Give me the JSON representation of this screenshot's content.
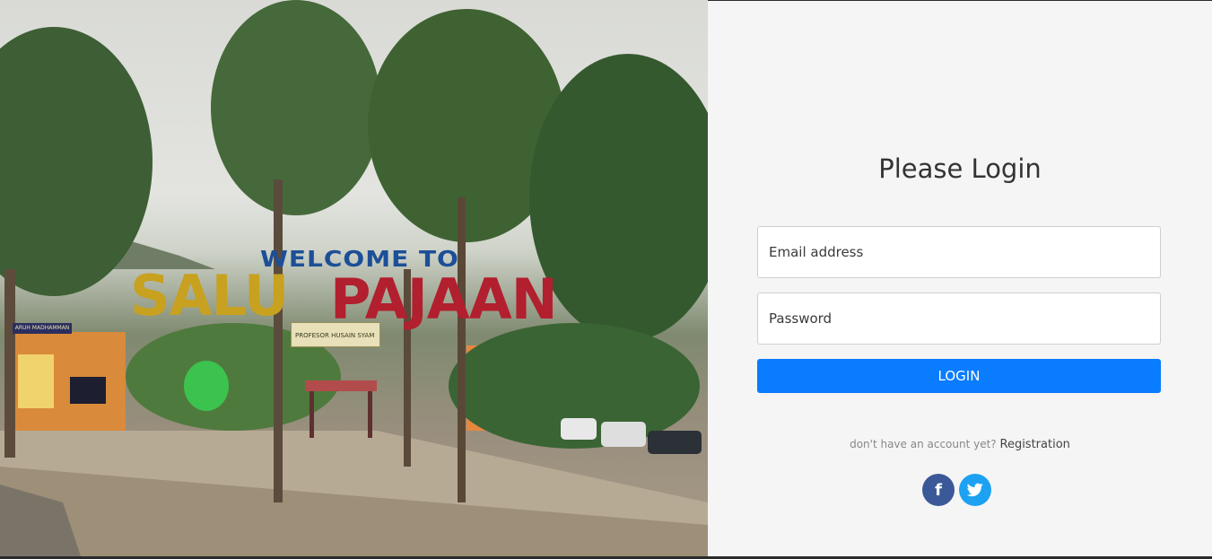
{
  "photo": {
    "sign_welcome": "WELCOME TO",
    "sign_salu": "SALU",
    "sign_pajaan": "PAJAAN",
    "banner_text": "PROFESOR HUSAIN SYAM",
    "mosque_sign": "ARUH MADHAMMAN"
  },
  "login": {
    "title": "Please Login",
    "email_placeholder": "Email address",
    "password_placeholder": "Password",
    "button_label": "LOGIN",
    "no_account_text": "don't have an account yet?",
    "registration_link": "Registration"
  },
  "social": {
    "facebook_glyph": "f",
    "twitter_glyph": "t",
    "facebook_icon": "facebook-icon",
    "twitter_icon": "twitter-icon"
  },
  "colors": {
    "accent": "#0a7cff",
    "panel_bg": "#f5f5f5",
    "facebook": "#3b5998",
    "twitter": "#1da1f2"
  }
}
